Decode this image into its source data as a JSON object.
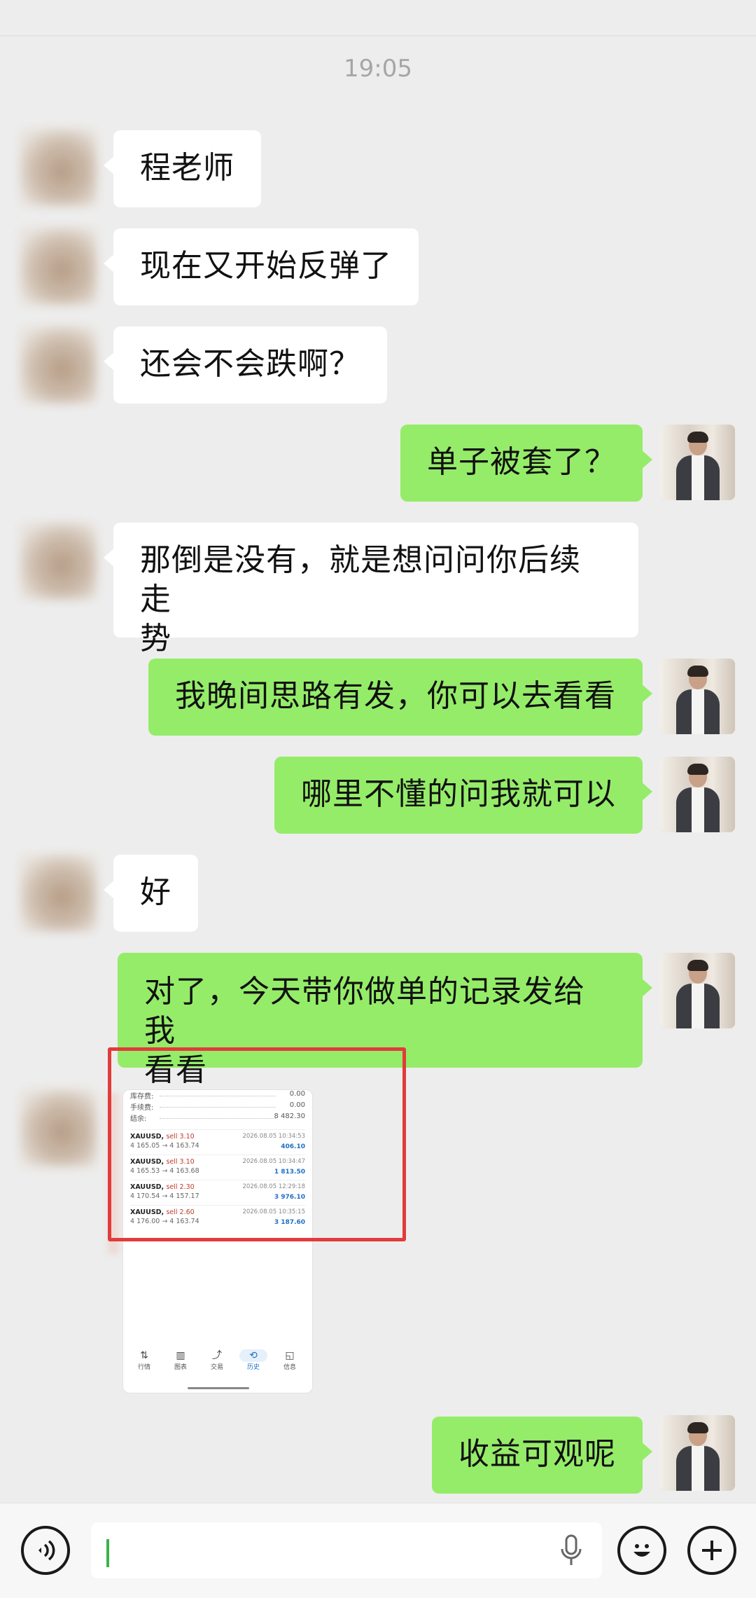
{
  "chat": {
    "timestamp": "19:05",
    "messages": [
      {
        "side": "in",
        "text": "程老师"
      },
      {
        "side": "in",
        "text": "现在又开始反弹了"
      },
      {
        "side": "in",
        "text": "还会不会跌啊？"
      },
      {
        "side": "out",
        "text": "单子被套了？"
      },
      {
        "side": "in",
        "text": "那倒是没有，就是想问问你后续走\n势"
      },
      {
        "side": "out",
        "text": "我晚间思路有发，你可以去看看"
      },
      {
        "side": "out",
        "text": "哪里不懂的问我就可以"
      },
      {
        "side": "in",
        "text": "好"
      },
      {
        "side": "out",
        "text": "对了，今天带你做单的记录发给我\n看看"
      },
      {
        "side": "out",
        "text": "收益可观呢"
      }
    ]
  },
  "screenshot": {
    "summary": [
      {
        "label": "库存费:",
        "value": "0.00"
      },
      {
        "label": "手续费:",
        "value": "0.00"
      },
      {
        "label": "结余:",
        "value": "8 482.30"
      }
    ],
    "trades": [
      {
        "symbol": "XAUUSD,",
        "side": "sell 3.10",
        "date": "2026.08.05 10:34:53",
        "prices": "4 165.05 → 4 163.74",
        "profit": "406.10"
      },
      {
        "symbol": "XAUUSD,",
        "side": "sell 3.10",
        "date": "2026.08.05 10:34:47",
        "prices": "4 165.53 → 4 163.68",
        "profit": "1 813.50"
      },
      {
        "symbol": "XAUUSD,",
        "side": "sell 2.30",
        "date": "2026.08.05 12:29:18",
        "prices": "4 170.54 → 4 157.17",
        "profit": "3 976.10"
      },
      {
        "symbol": "XAUUSD,",
        "side": "sell 2.60",
        "date": "2026.08.05 10:35:15",
        "prices": "4 176.00 → 4 163.74",
        "profit": "3 187.60"
      }
    ],
    "nav": [
      {
        "icon": "⇅",
        "label": "行情"
      },
      {
        "icon": "▥",
        "label": "图表"
      },
      {
        "icon": "⤴",
        "label": "交易"
      },
      {
        "icon": "⟲",
        "label": "历史",
        "active": true
      },
      {
        "icon": "◱",
        "label": "信息"
      }
    ]
  },
  "inputbar": {
    "voice_icon": "voice-icon",
    "mic_icon": "microphone-icon",
    "emoji_icon": "emoji-icon",
    "plus_icon": "plus-icon"
  },
  "colors": {
    "background": "#ededed",
    "outgoing_bubble": "#95ec69",
    "incoming_bubble": "#ffffff",
    "highlight_box": "#e23b3b"
  }
}
